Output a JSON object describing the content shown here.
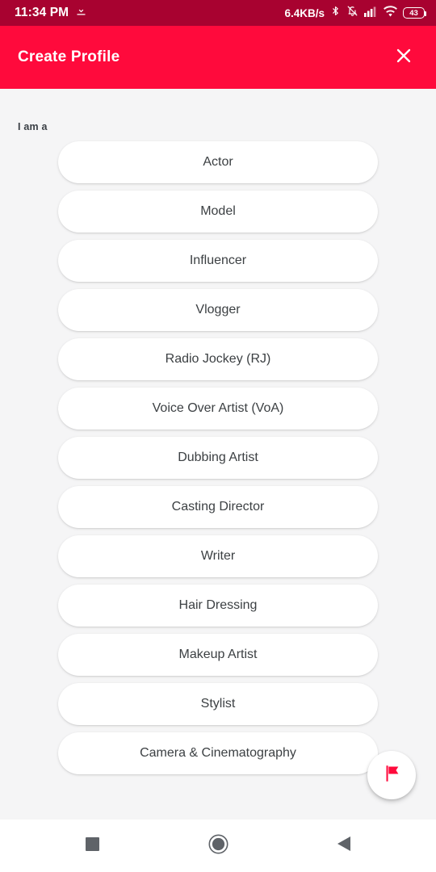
{
  "status_bar": {
    "time": "11:34 PM",
    "download_icon": "download-icon",
    "network_speed": "6.4KB/s",
    "bluetooth_icon": "bluetooth-icon",
    "silent_icon": "bell-muted-icon",
    "signal_icon": "cellular-signal-icon",
    "wifi_icon": "wifi-icon",
    "battery_level": "43",
    "background_color": "#a80230",
    "text_color": "#ffffff"
  },
  "header": {
    "title": "Create Profile",
    "close_icon": "close-icon",
    "background_color": "#ff0a3c",
    "text_color": "#ffffff"
  },
  "main": {
    "section_label": "I am a",
    "background_color": "#f5f5f6",
    "pill_color": "#ffffff",
    "pill_text_color": "#3c4043",
    "options": [
      {
        "label": "Actor"
      },
      {
        "label": "Model"
      },
      {
        "label": "Influencer"
      },
      {
        "label": "Vlogger"
      },
      {
        "label": "Radio Jockey (RJ)"
      },
      {
        "label": "Voice Over Artist (VoA)"
      },
      {
        "label": "Dubbing Artist"
      },
      {
        "label": "Casting Director"
      },
      {
        "label": "Writer"
      },
      {
        "label": "Hair Dressing"
      },
      {
        "label": "Makeup Artist"
      },
      {
        "label": "Stylist"
      },
      {
        "label": "Camera & Cinematography"
      }
    ]
  },
  "fab": {
    "icon": "flag-icon",
    "icon_color": "#ff0a3c",
    "background_color": "#ffffff"
  },
  "nav_bar": {
    "background_color": "#ffffff",
    "icon_color": "#5f6368",
    "buttons": [
      {
        "name": "recents",
        "icon": "square-icon"
      },
      {
        "name": "home",
        "icon": "circle-icon"
      },
      {
        "name": "back",
        "icon": "triangle-left-icon"
      }
    ]
  }
}
